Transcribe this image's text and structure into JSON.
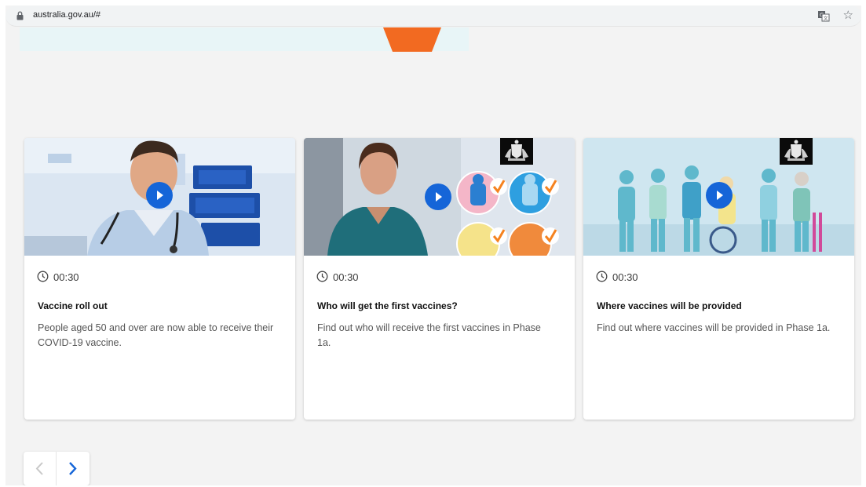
{
  "browser": {
    "url": "australia.gov.au/#"
  },
  "colors": {
    "accent_orange": "#f26a21",
    "play_blue": "#1565d8",
    "band_teal": "#e8f5f7",
    "check_orange": "#f5821f"
  },
  "cards": [
    {
      "duration": "00:30",
      "title": "Vaccine roll out",
      "description": "People aged 50 and over are now able to receive their COVID-19 vaccine.",
      "thumbnail": "doctor-in-clinic",
      "has_crest": false
    },
    {
      "duration": "00:30",
      "title": "Who will get the first vaccines?",
      "description": "Find out who will receive the first vaccines in Phase 1a.",
      "thumbnail": "nurse-with-priority-groups",
      "has_crest": true
    },
    {
      "duration": "00:30",
      "title": "Where vaccines will be provided",
      "description": "Find out where vaccines will be provided in Phase 1a.",
      "thumbnail": "illustrated-people-group",
      "has_crest": true
    }
  ],
  "pager": {
    "prev_icon": "chevron-left-icon",
    "next_icon": "chevron-right-icon",
    "prev_enabled": false
  }
}
